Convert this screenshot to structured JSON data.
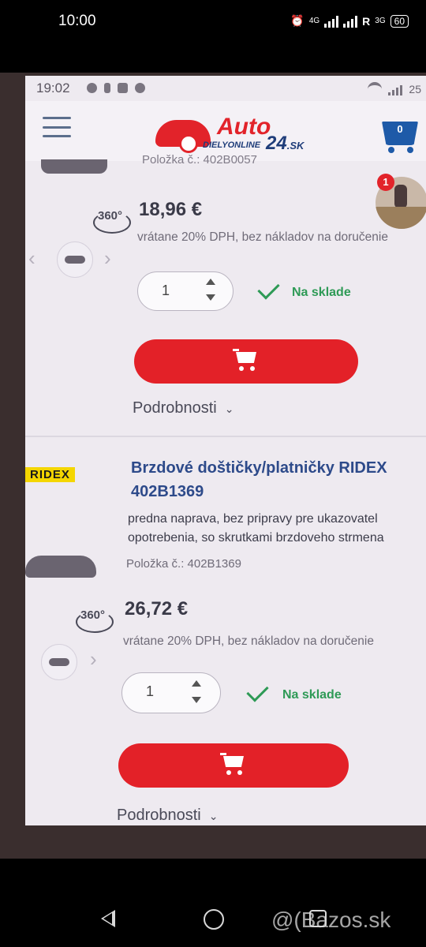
{
  "outer_status": {
    "time": "10:00",
    "network_1": "4G",
    "network_2": "R",
    "network_3": "3G",
    "battery": "60"
  },
  "device_status": {
    "time": "19:02",
    "battery": "25"
  },
  "header": {
    "logo_auto": "Auto",
    "logo_dielyonline": "DIELYONLINE",
    "logo_24": "24",
    "logo_sk": ".SK",
    "cart_count": "0"
  },
  "chat": {
    "badge": "1"
  },
  "products": [
    {
      "item_number": "Položka č.: 402B0057",
      "price": "18,96 €",
      "vat_note": "vrátane 20% DPH, bez nákladov na doručenie",
      "quantity": "1",
      "stock": "Na sklade",
      "details_label": "Podrobnosti",
      "view_360": "360°"
    },
    {
      "brand": "RIDEX",
      "title_line1": "Brzdové doštičky/platničky RIDEX",
      "title_line2": "402B1369",
      "desc_line1": "predna naprava, bez pripravy pre ukazovatel",
      "desc_line2": "opotrebenia, so skrutkami brzdoveho strmena",
      "item_number": "Položka č.: 402B1369",
      "price": "26,72 €",
      "vat_note": "vrátane 20% DPH, bez nákladov na doručenie",
      "quantity": "1",
      "stock": "Na sklade",
      "details_label": "Podrobnosti",
      "view_360": "360°"
    }
  ],
  "watermark": "@(Bazos.sk",
  "colors": {
    "brand_red": "#e32128",
    "brand_blue": "#2d4a8a",
    "stock_green": "#2e9a56"
  }
}
